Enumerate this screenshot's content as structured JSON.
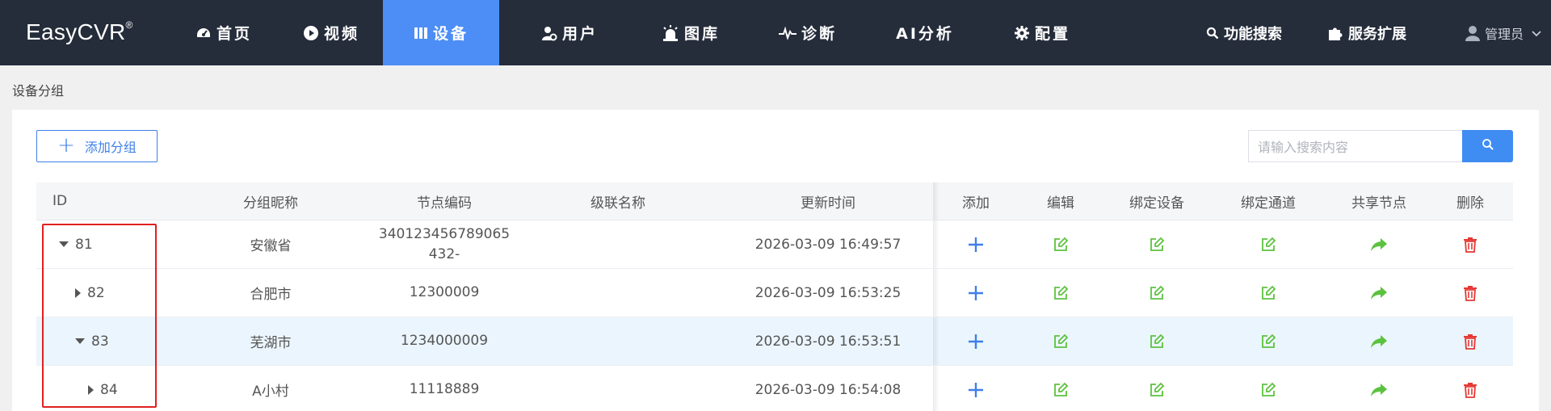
{
  "nav": {
    "logo": "EasyCVR",
    "logo_mark": "®",
    "items": [
      {
        "label": "首页",
        "icon": "dashboard-icon"
      },
      {
        "label": "视频",
        "icon": "play-icon"
      },
      {
        "label": "设备",
        "icon": "device-icon"
      },
      {
        "label": "用户",
        "icon": "user-gear-icon"
      },
      {
        "label": "图库",
        "icon": "alarm-icon"
      },
      {
        "label": "诊断",
        "icon": "pulse-icon"
      },
      {
        "label": "AI分析",
        "icon": ""
      },
      {
        "label": "配置",
        "icon": "gear-icon"
      }
    ],
    "active": "设备",
    "feature_search": "功能搜索",
    "service_expand": "服务扩展",
    "user": "管理员"
  },
  "breadcrumb": "设备分组",
  "toolbar": {
    "add_group": "添加分组",
    "search_placeholder": "请输入搜索内容"
  },
  "table": {
    "headers": [
      "ID",
      "分组昵称",
      "节点编码",
      "级联名称",
      "更新时间",
      "添加",
      "编辑",
      "绑定设备",
      "绑定通道",
      "共享节点",
      "删除"
    ],
    "rows": [
      {
        "id": "81",
        "name": "安徽省",
        "code_line1": "340123456789065",
        "code_line2": "432-",
        "cascade": "",
        "time": "2026-03-09 16:49:57",
        "expanded": true,
        "level": 0
      },
      {
        "id": "82",
        "name": "合肥市",
        "code_line1": "12300009",
        "code_line2": "",
        "cascade": "",
        "time": "2026-03-09 16:53:25",
        "expanded": false,
        "level": 1
      },
      {
        "id": "83",
        "name": "芜湖市",
        "code_line1": "1234000009",
        "code_line2": "",
        "cascade": "",
        "time": "2026-03-09 16:53:51",
        "expanded": true,
        "level": 1
      },
      {
        "id": "84",
        "name": "A小村",
        "code_line1": "11118889",
        "code_line2": "",
        "cascade": "",
        "time": "2026-03-09 16:54:08",
        "expanded": false,
        "level": 2
      }
    ]
  },
  "colors": {
    "nav_bg": "#252c3a",
    "active": "#4c8ef5",
    "primary": "#3f7fe8",
    "edit_green": "#5cc23e",
    "delete_red": "#e53935",
    "highlight_row": "#ebf5fd",
    "annotation_red": "#e02020"
  }
}
